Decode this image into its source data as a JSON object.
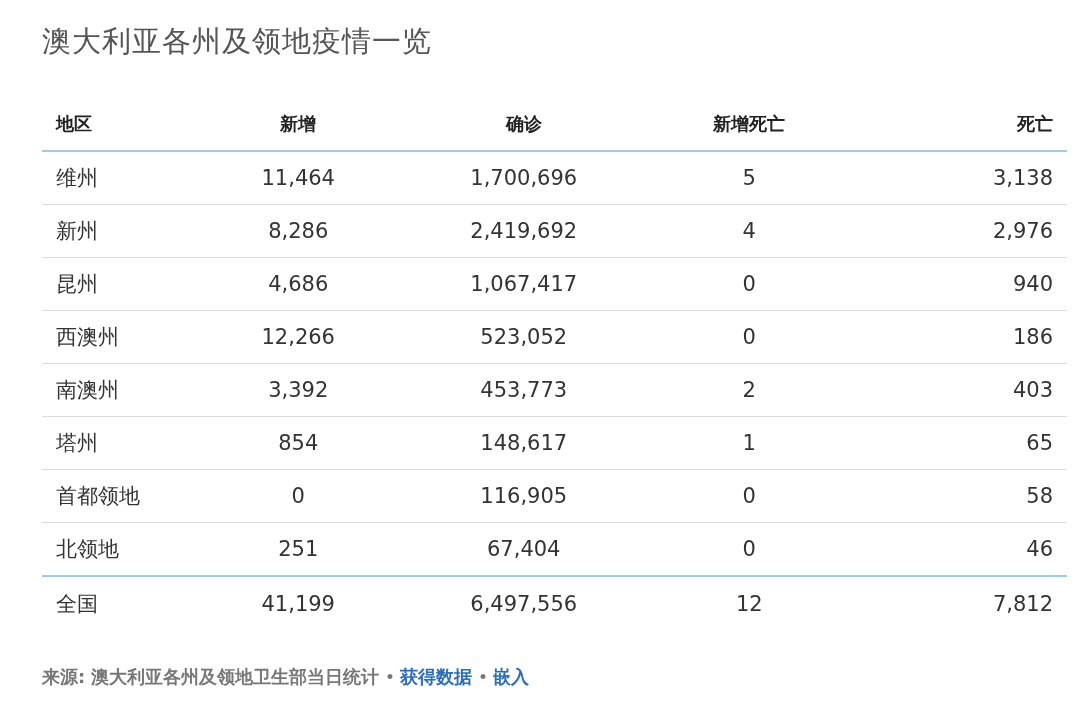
{
  "title": "澳大利亚各州及领地疫情一览",
  "table": {
    "columns": [
      "地区",
      "新增",
      "确诊",
      "新增死亡",
      "死亡"
    ],
    "rows": [
      [
        "维州",
        "11,464",
        "1,700,696",
        "5",
        "3,138"
      ],
      [
        "新州",
        "8,286",
        "2,419,692",
        "4",
        "2,976"
      ],
      [
        "昆州",
        "4,686",
        "1,067,417",
        "0",
        "940"
      ],
      [
        "西澳州",
        "12,266",
        "523,052",
        "0",
        "186"
      ],
      [
        "南澳州",
        "3,392",
        "453,773",
        "2",
        "403"
      ],
      [
        "塔州",
        "854",
        "148,617",
        "1",
        "65"
      ],
      [
        "首都领地",
        "0",
        "116,905",
        "0",
        "58"
      ],
      [
        "北领地",
        "251",
        "67,404",
        "0",
        "46"
      ]
    ],
    "total": [
      "全国",
      "41,199",
      "6,497,556",
      "12",
      "7,812"
    ]
  },
  "footer": {
    "source": "来源: 澳大利亚各州及领地卫生部当日统计",
    "links": [
      {
        "separator": "•",
        "label": "获得数据"
      },
      {
        "separator": "•",
        "label": "嵌入"
      }
    ]
  }
}
